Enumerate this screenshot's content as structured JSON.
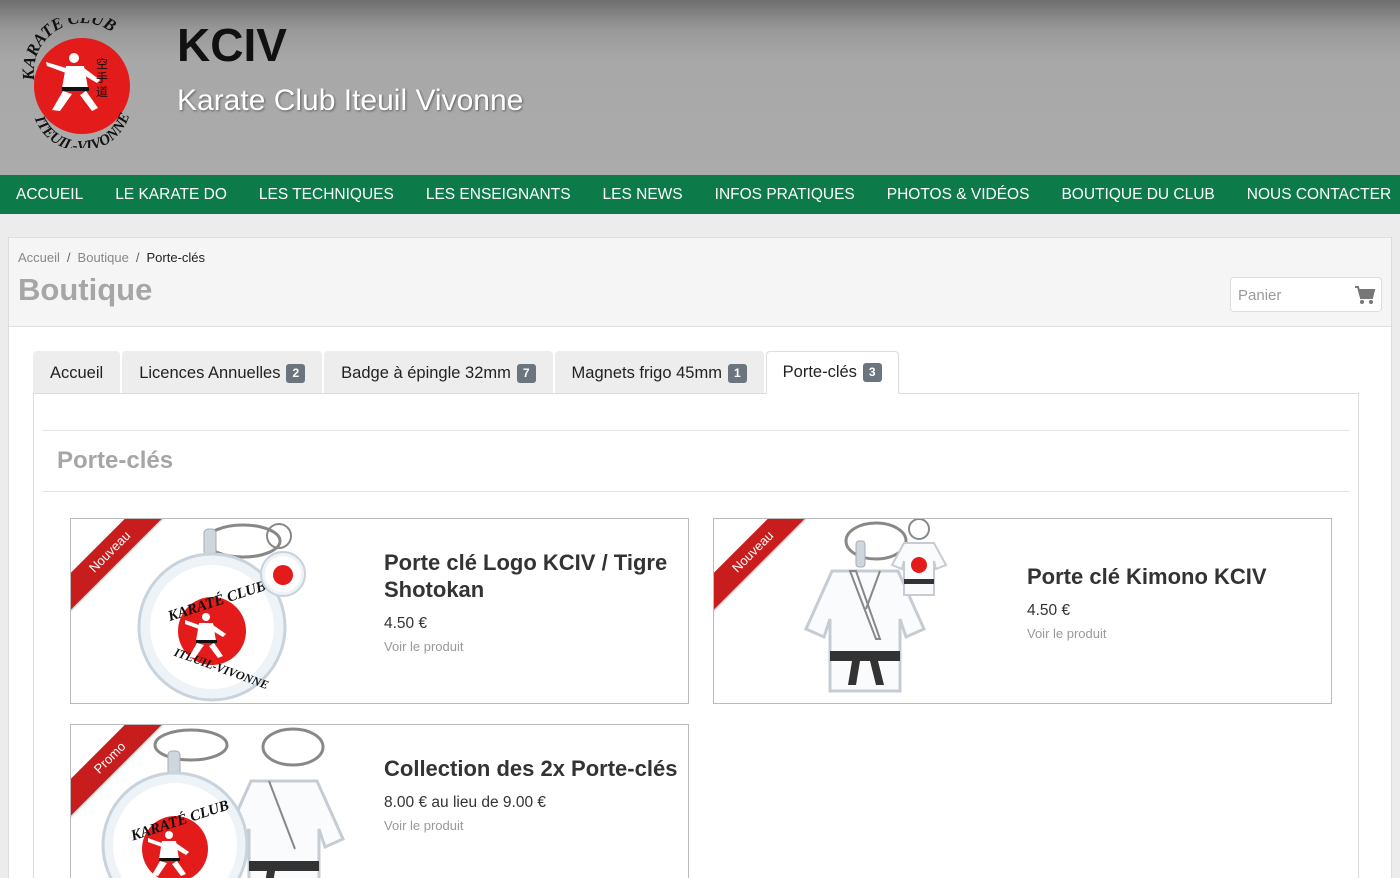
{
  "header": {
    "logo": {
      "top_text": "KARATÉ CLUB",
      "bottom_text": "ITEUIL-VIVONNE"
    },
    "site_name": "KCIV",
    "slogan": "Karate Club Iteuil Vivonne"
  },
  "nav": {
    "items": [
      "ACCUEIL",
      "LE KARATE DO",
      "LES TECHNIQUES",
      "LES ENSEIGNANTS",
      "LES NEWS",
      "INFOS PRATIQUES",
      "PHOTOS & VIDÉOS",
      "BOUTIQUE DU CLUB",
      "NOUS CONTACTER"
    ],
    "color": "#0d7a4a"
  },
  "breadcrumb": {
    "items": [
      "Accueil",
      "Boutique"
    ],
    "current": "Porte-clés",
    "separator": "/"
  },
  "page": {
    "title": "Boutique"
  },
  "cart": {
    "placeholder": "Panier",
    "icon": "cart-icon"
  },
  "tabs": [
    {
      "label": "Accueil",
      "count": ""
    },
    {
      "label": "Licences Annuelles",
      "count": "2"
    },
    {
      "label": "Badge à épingle 32mm",
      "count": "7"
    },
    {
      "label": "Magnets frigo 45mm",
      "count": "1"
    },
    {
      "label": "Porte-clés",
      "count": "3",
      "active": true
    }
  ],
  "section": {
    "title": "Porte-clés"
  },
  "products": [
    {
      "ribbon": "Nouveau",
      "name": "Porte clé Logo KCIV / Tigre Shotokan",
      "price": "4.50 €",
      "link": "Voir le produit"
    },
    {
      "ribbon": "Nouveau",
      "name": "Porte clé Kimono KCIV",
      "price": "4.50 €",
      "link": "Voir le produit"
    },
    {
      "ribbon": "Promo",
      "name": "Collection des 2x Porte-clés",
      "price": "8.00 € au lieu de 9.00 €",
      "link": "Voir le produit"
    }
  ],
  "colors": {
    "ribbon": "#c81d1d",
    "badge": "#6c757d",
    "logo_red": "#e31b1b"
  }
}
